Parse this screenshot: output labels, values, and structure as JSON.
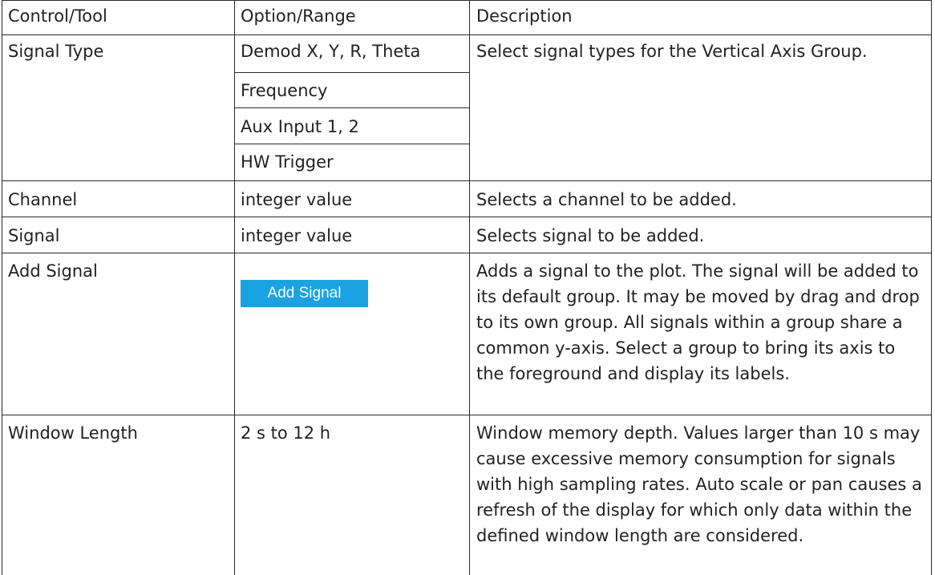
{
  "headers": {
    "control": "Control/Tool",
    "option": "Option/Range",
    "description": "Description"
  },
  "rows": {
    "signal_type": {
      "control": "Signal Type",
      "options": [
        "Demod X, Y, R, Theta",
        "Frequency",
        "Aux Input 1, 2",
        "HW Trigger"
      ],
      "description": "Select signal types for the Vertical Axis Group."
    },
    "channel": {
      "control": "Channel",
      "option": "integer value",
      "description": "Selects a channel to be added."
    },
    "signal": {
      "control": "Signal",
      "option": "integer value",
      "description": "Selects signal to be added."
    },
    "add_signal": {
      "control": "Add Signal",
      "button_label": "Add Signal",
      "description": "Adds a signal to the plot. The signal will be added to its default group. It may be moved by drag and drop to its own group. All signals within a group share a common y-axis. Select a group to bring its axis to the foreground and display its labels."
    },
    "window_length": {
      "control": "Window Length",
      "option": "2 s to 12 h",
      "description": "Window memory depth. Values larger than 10 s may cause excessive memory consumption for signals with high sampling rates. Auto scale or pan causes a refresh of the display for which only data within the defined window length are considered."
    }
  },
  "colors": {
    "button_bg": "#1aa3e3",
    "button_text": "#ffffff",
    "border": "#2a2a2a"
  }
}
